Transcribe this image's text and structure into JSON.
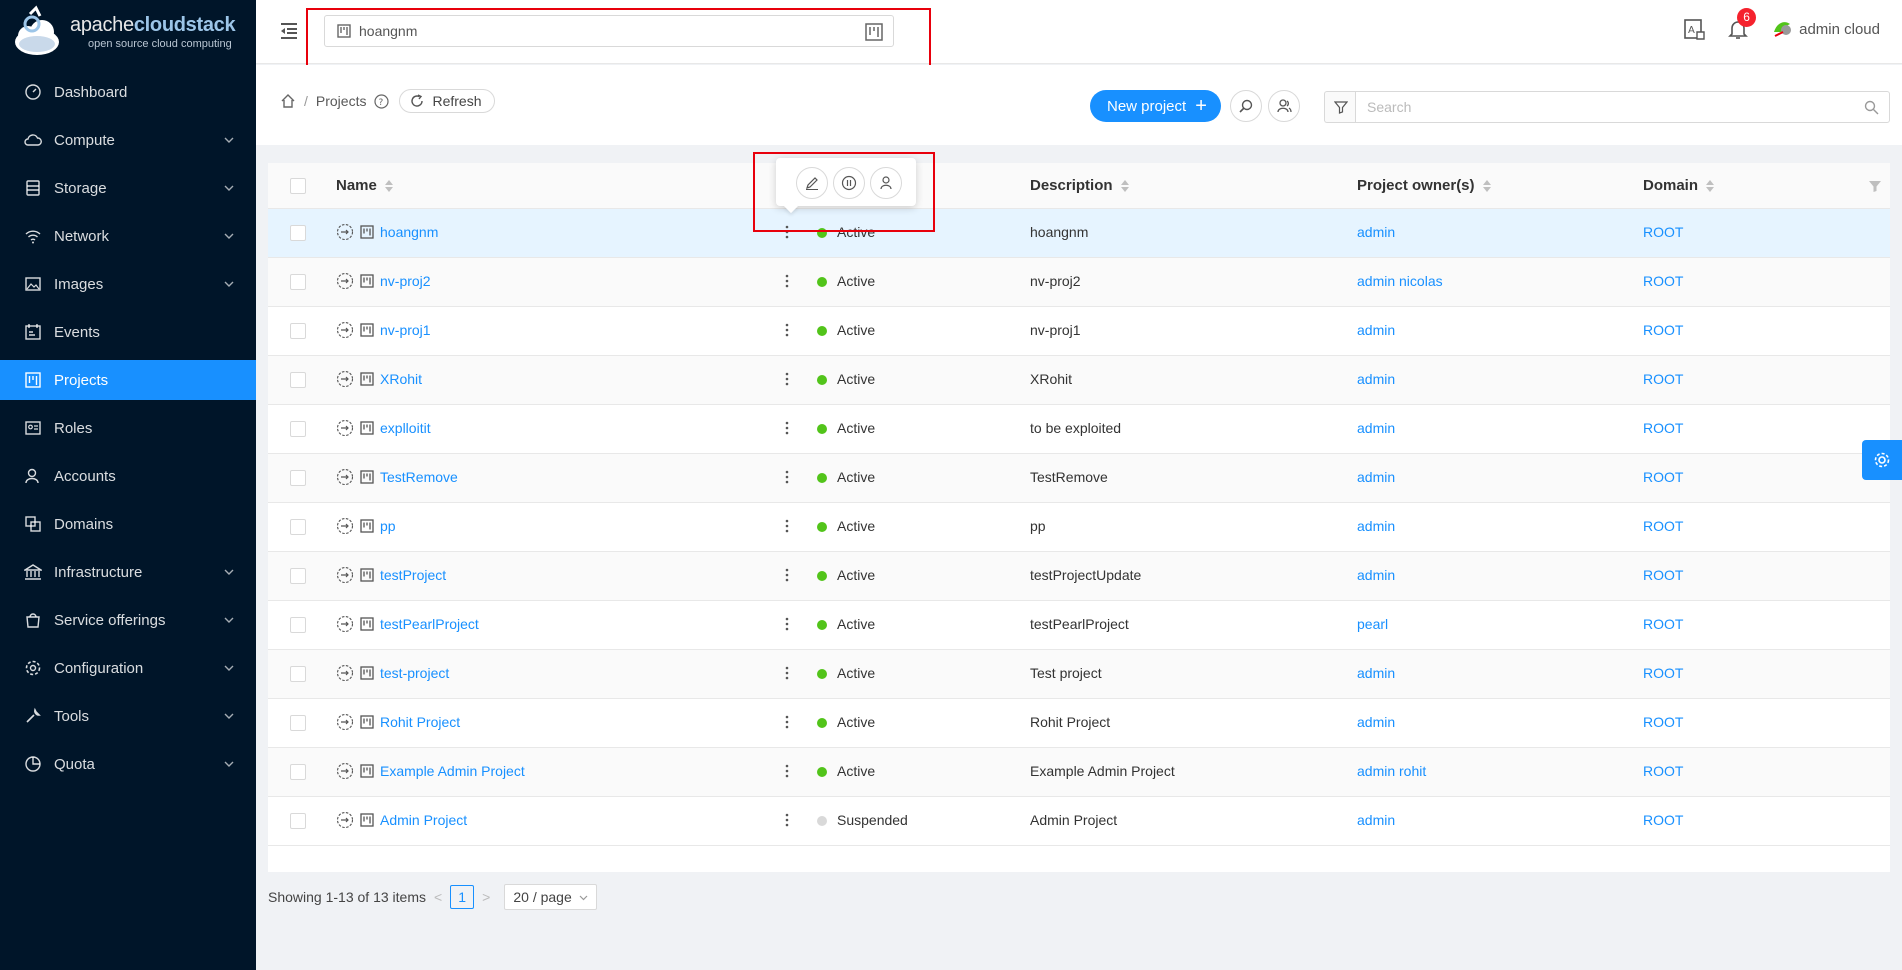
{
  "brand": {
    "name_thin": "apache",
    "name_bold": "cloudstack",
    "tagline": "open source cloud computing"
  },
  "sidebar": {
    "items": [
      {
        "label": "Dashboard",
        "icon": "dashboard-icon",
        "expandable": false
      },
      {
        "label": "Compute",
        "icon": "cloud-icon",
        "expandable": true
      },
      {
        "label": "Storage",
        "icon": "database-icon",
        "expandable": true
      },
      {
        "label": "Network",
        "icon": "wifi-icon",
        "expandable": true
      },
      {
        "label": "Images",
        "icon": "picture-icon",
        "expandable": true
      },
      {
        "label": "Events",
        "icon": "schedule-icon",
        "expandable": false
      },
      {
        "label": "Projects",
        "icon": "project-icon",
        "expandable": false,
        "active": true
      },
      {
        "label": "Roles",
        "icon": "idcard-icon",
        "expandable": false
      },
      {
        "label": "Accounts",
        "icon": "team-icon",
        "expandable": false
      },
      {
        "label": "Domains",
        "icon": "block-icon",
        "expandable": false
      },
      {
        "label": "Infrastructure",
        "icon": "bank-icon",
        "expandable": true
      },
      {
        "label": "Service offerings",
        "icon": "shopping-icon",
        "expandable": true
      },
      {
        "label": "Configuration",
        "icon": "setting-icon",
        "expandable": true
      },
      {
        "label": "Tools",
        "icon": "tool-icon",
        "expandable": true
      },
      {
        "label": "Quota",
        "icon": "piechart-icon",
        "expandable": true
      }
    ]
  },
  "header": {
    "project_selector": "hoangnm",
    "notifications_count": "6",
    "user_name": "admin cloud"
  },
  "toolbar": {
    "breadcrumb_current": "Projects",
    "refresh_label": "Refresh",
    "new_project_label": "New project",
    "search_placeholder": "Search"
  },
  "table": {
    "columns": {
      "name": "Name",
      "description": "Description",
      "owners": "Project owner(s)",
      "domain": "Domain"
    },
    "rows": [
      {
        "name": "hoangnm",
        "state": "Active",
        "description": "hoangnm",
        "owners": "admin",
        "domain": "ROOT"
      },
      {
        "name": "nv-proj2",
        "state": "Active",
        "description": "nv-proj2",
        "owners": "admin  nicolas",
        "domain": "ROOT"
      },
      {
        "name": "nv-proj1",
        "state": "Active",
        "description": "nv-proj1",
        "owners": "admin",
        "domain": "ROOT"
      },
      {
        "name": "XRohit",
        "state": "Active",
        "description": "XRohit",
        "owners": "admin",
        "domain": "ROOT"
      },
      {
        "name": "explloitit",
        "state": "Active",
        "description": "to be exploited",
        "owners": "admin",
        "domain": "ROOT"
      },
      {
        "name": "TestRemove",
        "state": "Active",
        "description": "TestRemove",
        "owners": "admin",
        "domain": "ROOT"
      },
      {
        "name": "pp",
        "state": "Active",
        "description": "pp",
        "owners": "admin",
        "domain": "ROOT"
      },
      {
        "name": "testProject",
        "state": "Active",
        "description": "testProjectUpdate",
        "owners": "admin",
        "domain": "ROOT"
      },
      {
        "name": "testPearlProject",
        "state": "Active",
        "description": "testPearlProject",
        "owners": "pearl",
        "domain": "ROOT"
      },
      {
        "name": "test-project",
        "state": "Active",
        "description": "Test project",
        "owners": "admin",
        "domain": "ROOT"
      },
      {
        "name": "Rohit Project",
        "state": "Active",
        "description": "Rohit Project",
        "owners": "admin",
        "domain": "ROOT"
      },
      {
        "name": "Example Admin Project",
        "state": "Active",
        "description": "Example Admin Project",
        "owners": "admin  rohit",
        "domain": "ROOT"
      },
      {
        "name": "Admin Project",
        "state": "Suspended",
        "description": "Admin Project",
        "owners": "admin",
        "domain": "ROOT"
      }
    ]
  },
  "pagination": {
    "summary": "Showing 1-13 of 13 items",
    "current_page": "1",
    "page_size": "20 / page"
  },
  "colors": {
    "accent": "#1890ff",
    "sidebar_bg": "#001529",
    "active_state": "#52c41a",
    "suspended_state": "#d9d9d9",
    "highlight": "#e8000c"
  }
}
